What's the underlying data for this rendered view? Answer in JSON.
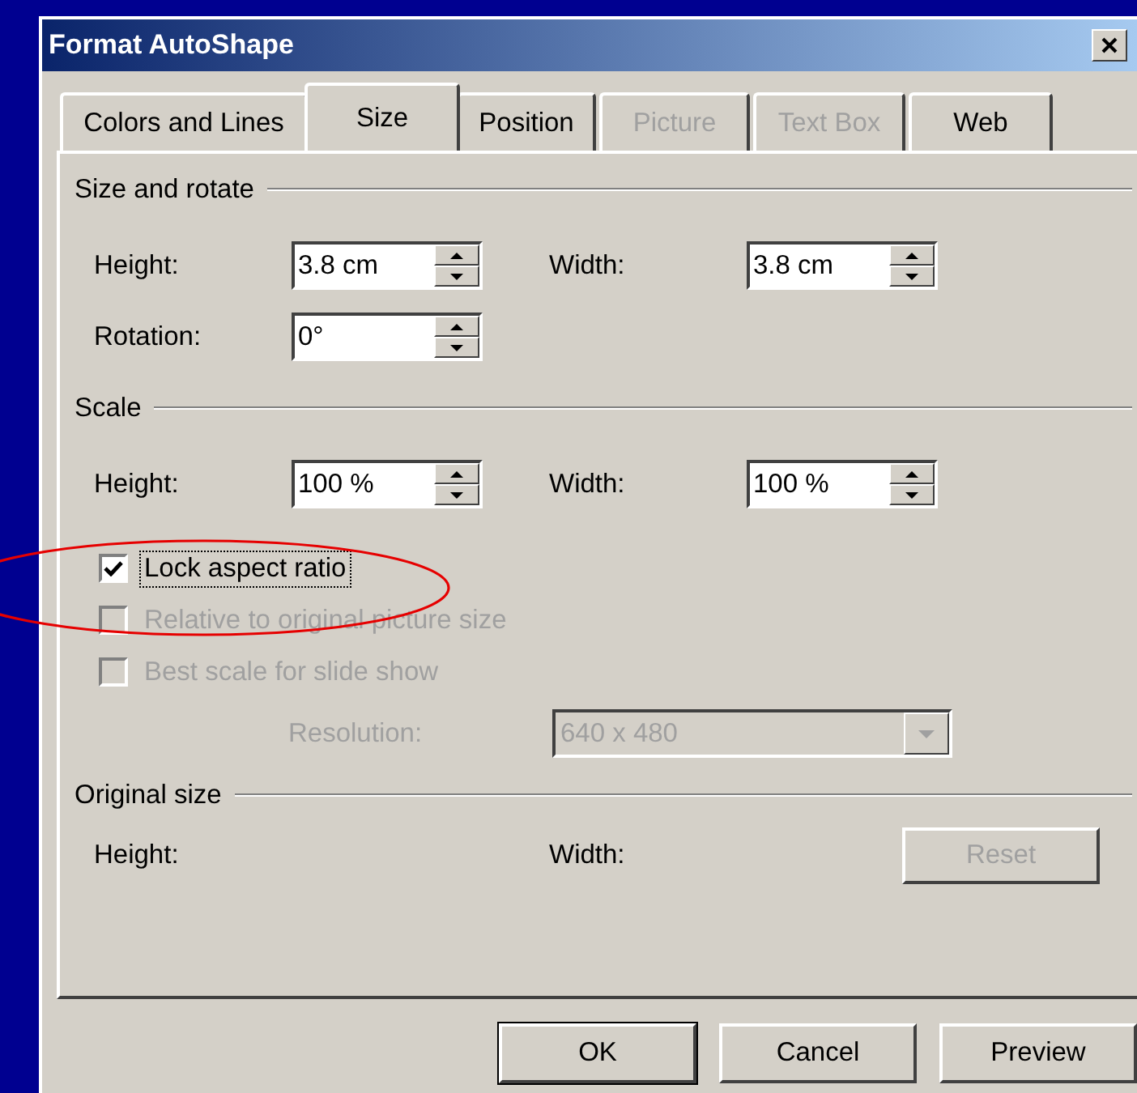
{
  "window": {
    "title": "Format AutoShape"
  },
  "tabs": [
    {
      "label": "Colors and Lines",
      "selected": false,
      "disabled": false
    },
    {
      "label": "Size",
      "selected": true,
      "disabled": false
    },
    {
      "label": "Position",
      "selected": false,
      "disabled": false
    },
    {
      "label": "Picture",
      "selected": false,
      "disabled": true
    },
    {
      "label": "Text Box",
      "selected": false,
      "disabled": true
    },
    {
      "label": "Web",
      "selected": false,
      "disabled": false
    }
  ],
  "size_and_rotate": {
    "title": "Size and rotate",
    "height": {
      "label": "Height:",
      "value": "3.8 cm"
    },
    "width": {
      "label": "Width:",
      "value": "3.8 cm"
    },
    "rotation": {
      "label": "Rotation:",
      "value": "0°"
    }
  },
  "scale": {
    "title": "Scale",
    "height": {
      "label": "Height:",
      "value": "100 %"
    },
    "width": {
      "label": "Width:",
      "value": "100 %"
    },
    "options": [
      {
        "label": "Lock aspect ratio",
        "checked": true,
        "disabled": false,
        "focused": true
      },
      {
        "label": "Relative to original picture size",
        "checked": false,
        "disabled": true,
        "focused": false
      },
      {
        "label": "Best scale for slide show",
        "checked": false,
        "disabled": true,
        "focused": false
      }
    ],
    "resolution": {
      "label": "Resolution:",
      "value": "640 x 480",
      "disabled": true
    }
  },
  "original_size": {
    "title": "Original size",
    "height_label": "Height:",
    "width_label": "Width:",
    "reset": {
      "label": "Reset",
      "disabled": true
    }
  },
  "buttons": [
    {
      "label": "OK",
      "default": true
    },
    {
      "label": "Cancel",
      "default": false
    },
    {
      "label": "Preview",
      "default": false
    }
  ],
  "annotation": {
    "kind": "ellipse"
  }
}
